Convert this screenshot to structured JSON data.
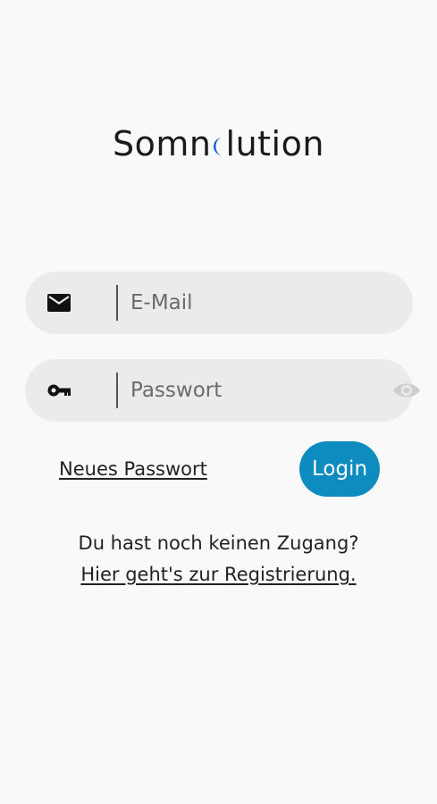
{
  "app": {
    "logo_left": "Somn",
    "logo_right": "lution",
    "accent_color": "#1a5fd6"
  },
  "login_form": {
    "email_placeholder": "E-Mail",
    "password_placeholder": "Passwort",
    "email_icon": "mail-icon",
    "password_icon": "key-icon",
    "visibility_icon": "eye-icon"
  },
  "actions": {
    "forgot_password": "Neues Passwort",
    "login": "Login",
    "login_color": "#0e8cc0"
  },
  "register": {
    "prompt": "Du hast noch keinen Zugang?",
    "link": "Hier geht's zur Registrierung."
  }
}
